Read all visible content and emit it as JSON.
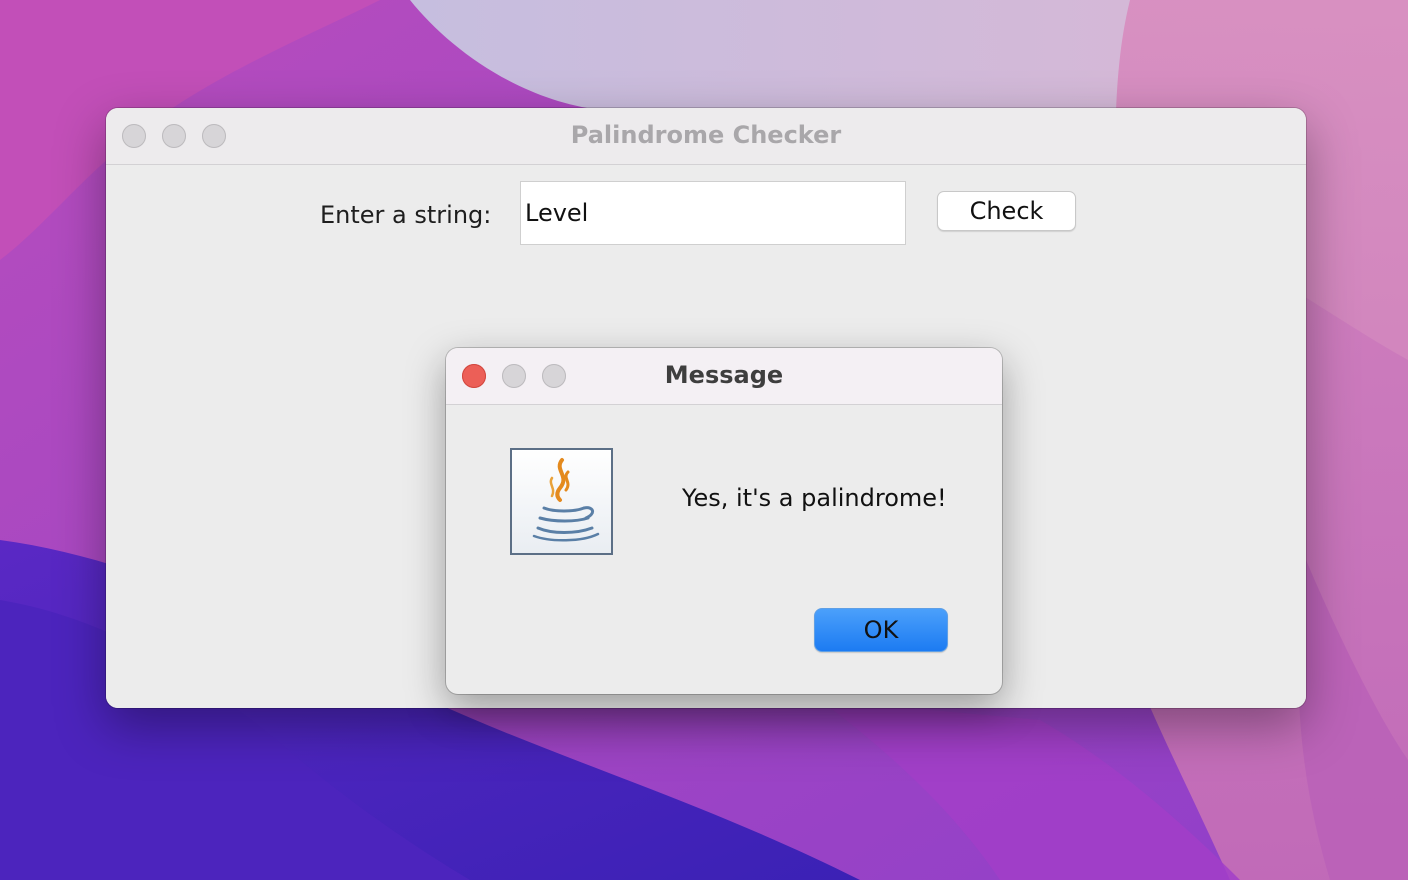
{
  "main_window": {
    "title": "Palindrome Checker",
    "input_label": "Enter a string:",
    "input_value": "Level",
    "check_button_label": "Check"
  },
  "dialog": {
    "title": "Message",
    "icon": "java-coffee-cup-icon",
    "message": "Yes, it's a palindrome!",
    "ok_button_label": "OK"
  },
  "colors": {
    "close_button": "#ec5f57",
    "default_button": "#2d8cf6",
    "window_background": "#ececec"
  }
}
